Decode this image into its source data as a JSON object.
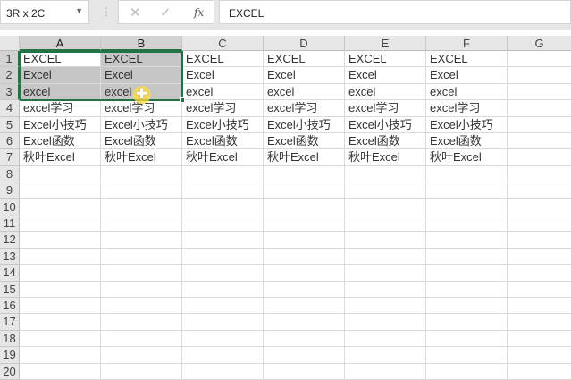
{
  "name_box": "3R x 2C",
  "formula_bar": {
    "cancel_icon": "✕",
    "enter_icon": "✓",
    "fx_label": "fx",
    "value": "EXCEL"
  },
  "columns": [
    "A",
    "B",
    "C",
    "D",
    "E",
    "F",
    "G"
  ],
  "rows": [
    "1",
    "2",
    "3",
    "4",
    "5",
    "6",
    "7",
    "8",
    "9",
    "10",
    "11",
    "12",
    "13",
    "14",
    "15",
    "16",
    "17",
    "18",
    "19",
    "20"
  ],
  "row_data": [
    [
      "EXCEL",
      "EXCEL",
      "EXCEL",
      "EXCEL",
      "EXCEL",
      "EXCEL"
    ],
    [
      "Excel",
      "Excel",
      "Excel",
      "Excel",
      "Excel",
      "Excel"
    ],
    [
      "excel",
      "excel",
      "excel",
      "excel",
      "excel",
      "excel"
    ],
    [
      "excel学习",
      "excel学习",
      "excel学习",
      "excel学习",
      "excel学习",
      "excel学习"
    ],
    [
      "Excel小技巧",
      "Excel小技巧",
      "Excel小技巧",
      "Excel小技巧",
      "Excel小技巧",
      "Excel小技巧"
    ],
    [
      "Excel函数",
      "Excel函数",
      "Excel函数",
      "Excel函数",
      "Excel函数",
      "Excel函数"
    ],
    [
      "秋叶Excel",
      "秋叶Excel",
      "秋叶Excel",
      "秋叶Excel",
      "秋叶Excel",
      "秋叶Excel"
    ]
  ],
  "selection": "A1:B3",
  "accent": "#217346"
}
